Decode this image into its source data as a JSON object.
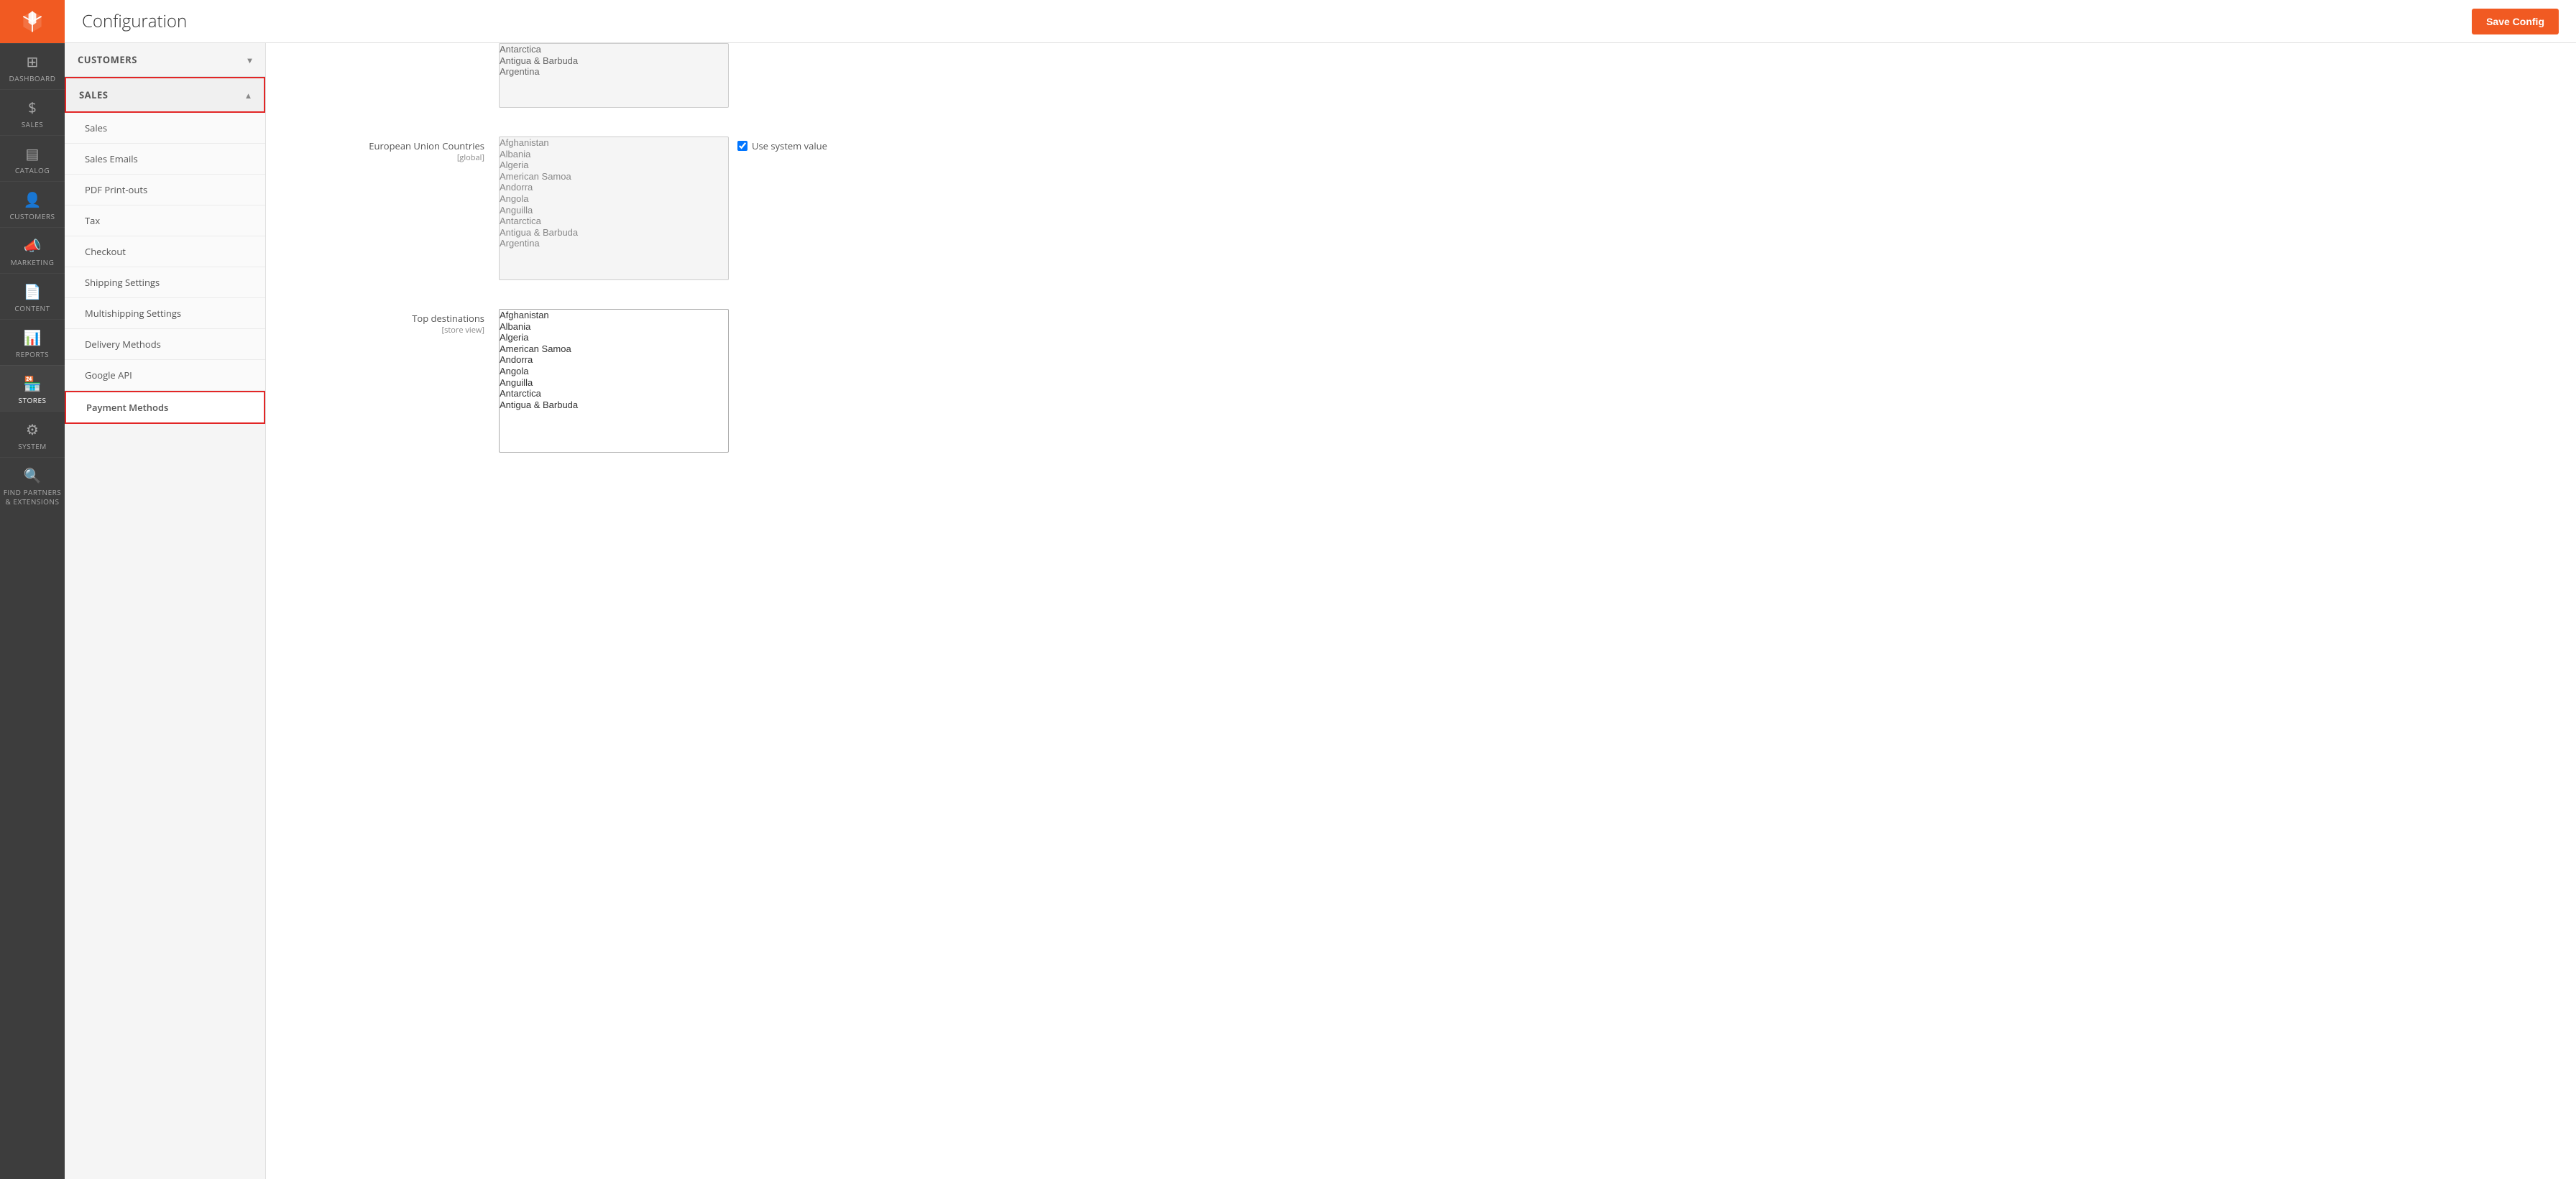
{
  "app": {
    "title": "Magento"
  },
  "header": {
    "page_title": "Configuration",
    "save_button_label": "Save Config"
  },
  "sidebar": {
    "items": [
      {
        "id": "dashboard",
        "label": "DASHBOARD",
        "icon": "⊞"
      },
      {
        "id": "sales",
        "label": "SALES",
        "icon": "$"
      },
      {
        "id": "catalog",
        "label": "CATALOG",
        "icon": "🗂"
      },
      {
        "id": "customers",
        "label": "CUSTOMERS",
        "icon": "👤"
      },
      {
        "id": "marketing",
        "label": "MARKETING",
        "icon": "📣"
      },
      {
        "id": "content",
        "label": "CONTENT",
        "icon": "📄"
      },
      {
        "id": "reports",
        "label": "REPORTS",
        "icon": "📊"
      },
      {
        "id": "stores",
        "label": "STORES",
        "icon": "🏪"
      },
      {
        "id": "system",
        "label": "SYSTEM",
        "icon": "⚙"
      },
      {
        "id": "find",
        "label": "FIND PARTNERS & EXTENSIONS",
        "icon": "🔍"
      }
    ]
  },
  "config_panel": {
    "sections": [
      {
        "id": "customers",
        "label": "CUSTOMERS",
        "expanded": false,
        "active": false,
        "items": []
      },
      {
        "id": "sales",
        "label": "SALES",
        "expanded": true,
        "active": true,
        "items": [
          {
            "id": "sales",
            "label": "Sales",
            "active": false
          },
          {
            "id": "sales-emails",
            "label": "Sales Emails",
            "active": false
          },
          {
            "id": "pdf-printouts",
            "label": "PDF Print-outs",
            "active": false
          },
          {
            "id": "tax",
            "label": "Tax",
            "active": false
          },
          {
            "id": "checkout",
            "label": "Checkout",
            "active": false
          },
          {
            "id": "shipping-settings",
            "label": "Shipping Settings",
            "active": false
          },
          {
            "id": "multishipping-settings",
            "label": "Multishipping Settings",
            "active": false
          },
          {
            "id": "delivery-methods",
            "label": "Delivery Methods",
            "active": false
          },
          {
            "id": "google-api",
            "label": "Google API",
            "active": false
          },
          {
            "id": "payment-methods",
            "label": "Payment Methods",
            "active": true
          }
        ]
      }
    ]
  },
  "main_content": {
    "eu_countries": {
      "label": "European Union Countries",
      "sublabel": "[global]",
      "list_items_inactive": [
        "Afghanistan",
        "Albania",
        "Algeria",
        "American Samoa",
        "Andorra",
        "Angola",
        "Anguilla",
        "Antarctica",
        "Antigua & Barbuda",
        "Argentina"
      ],
      "use_system_value": true,
      "use_system_value_label": "Use system value"
    },
    "top_destinations": {
      "label": "Top destinations",
      "sublabel": "[store view]",
      "list_items": [
        "Afghanistan",
        "Albania",
        "Algeria",
        "American Samoa",
        "Andorra",
        "Angola",
        "Anguilla",
        "Antarctica",
        "Antigua & Barbuda"
      ]
    },
    "above_eu": {
      "list_items": [
        "Antarctica",
        "Antigua & Barbuda",
        "Argentina"
      ]
    }
  },
  "colors": {
    "orange": "#f15a22",
    "sidebar_bg": "#3d3d3d",
    "active_border": "#e22626"
  }
}
